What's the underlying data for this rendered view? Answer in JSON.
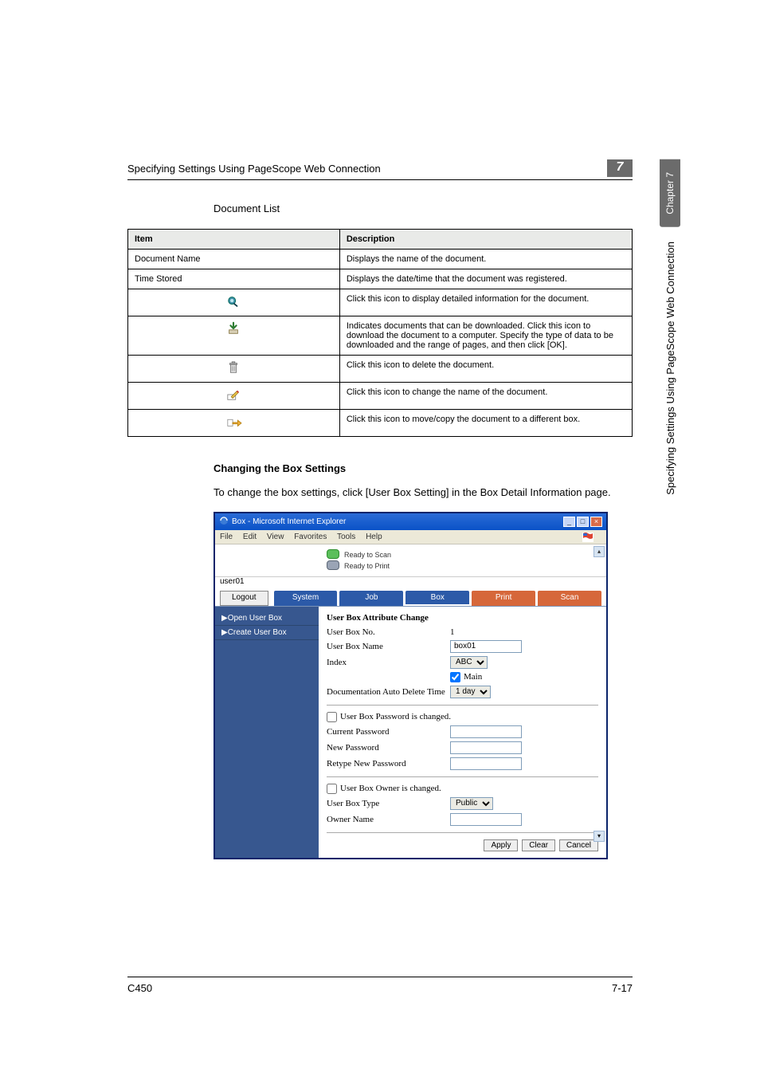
{
  "header": {
    "title": "Specifying Settings Using PageScope Web Connection",
    "badge": "7"
  },
  "sidebar": {
    "tab": "Chapter 7",
    "text": "Specifying Settings Using PageScope Web Connection"
  },
  "doc_list_heading": "Document List",
  "table": {
    "headers": [
      "Item",
      "Description"
    ],
    "rows": [
      {
        "item": "Document Name",
        "desc": "Displays the name of the document."
      },
      {
        "item": "Time Stored",
        "desc": "Displays the date/time that the document was registered."
      },
      {
        "icon": "magnifier",
        "desc": "Click this icon to display detailed information for the document."
      },
      {
        "icon": "download",
        "desc": "Indicates documents that can be downloaded. Click this icon to download the document to a computer. Specify the type of data to be downloaded and the range of pages, and then click [OK]."
      },
      {
        "icon": "trash",
        "desc": "Click this icon to delete the document."
      },
      {
        "icon": "rename",
        "desc": "Click this icon to change the name of the document."
      },
      {
        "icon": "move",
        "desc": "Click this icon to move/copy the document to a different box."
      }
    ]
  },
  "section2": {
    "heading": "Changing the Box Settings",
    "body": "To change the box settings, click [User Box Setting] in the Box Detail Information page."
  },
  "screenshot": {
    "title": "Box - Microsoft Internet Explorer",
    "menu": [
      "File",
      "Edit",
      "View",
      "Favorites",
      "Tools",
      "Help"
    ],
    "status_scan": "Ready to Scan",
    "status_print": "Ready to Print",
    "user": "user01",
    "logout": "Logout",
    "tabs": {
      "system": "System",
      "job": "Job",
      "box": "Box",
      "print": "Print",
      "scan": "Scan"
    },
    "side": {
      "open": "▶Open User Box",
      "create": "▶Create User Box"
    },
    "form": {
      "heading": "User Box Attribute Change",
      "box_no_label": "User Box No.",
      "box_no_value": "1",
      "box_name_label": "User Box Name",
      "box_name_value": "box01",
      "index_label": "Index",
      "index_value": "ABC",
      "main_checkbox": "Main",
      "auto_del_label": "Documentation Auto Delete Time",
      "auto_del_value": "1 day",
      "pw_changed": "User Box Password is changed.",
      "cur_pw": "Current Password",
      "new_pw": "New Password",
      "retype_pw": "Retype New Password",
      "owner_changed": "User Box Owner is changed.",
      "box_type_label": "User Box Type",
      "box_type_value": "Public",
      "owner_name": "Owner Name",
      "apply": "Apply",
      "clear": "Clear",
      "cancel": "Cancel"
    }
  },
  "footer": {
    "left": "C450",
    "right": "7-17"
  }
}
